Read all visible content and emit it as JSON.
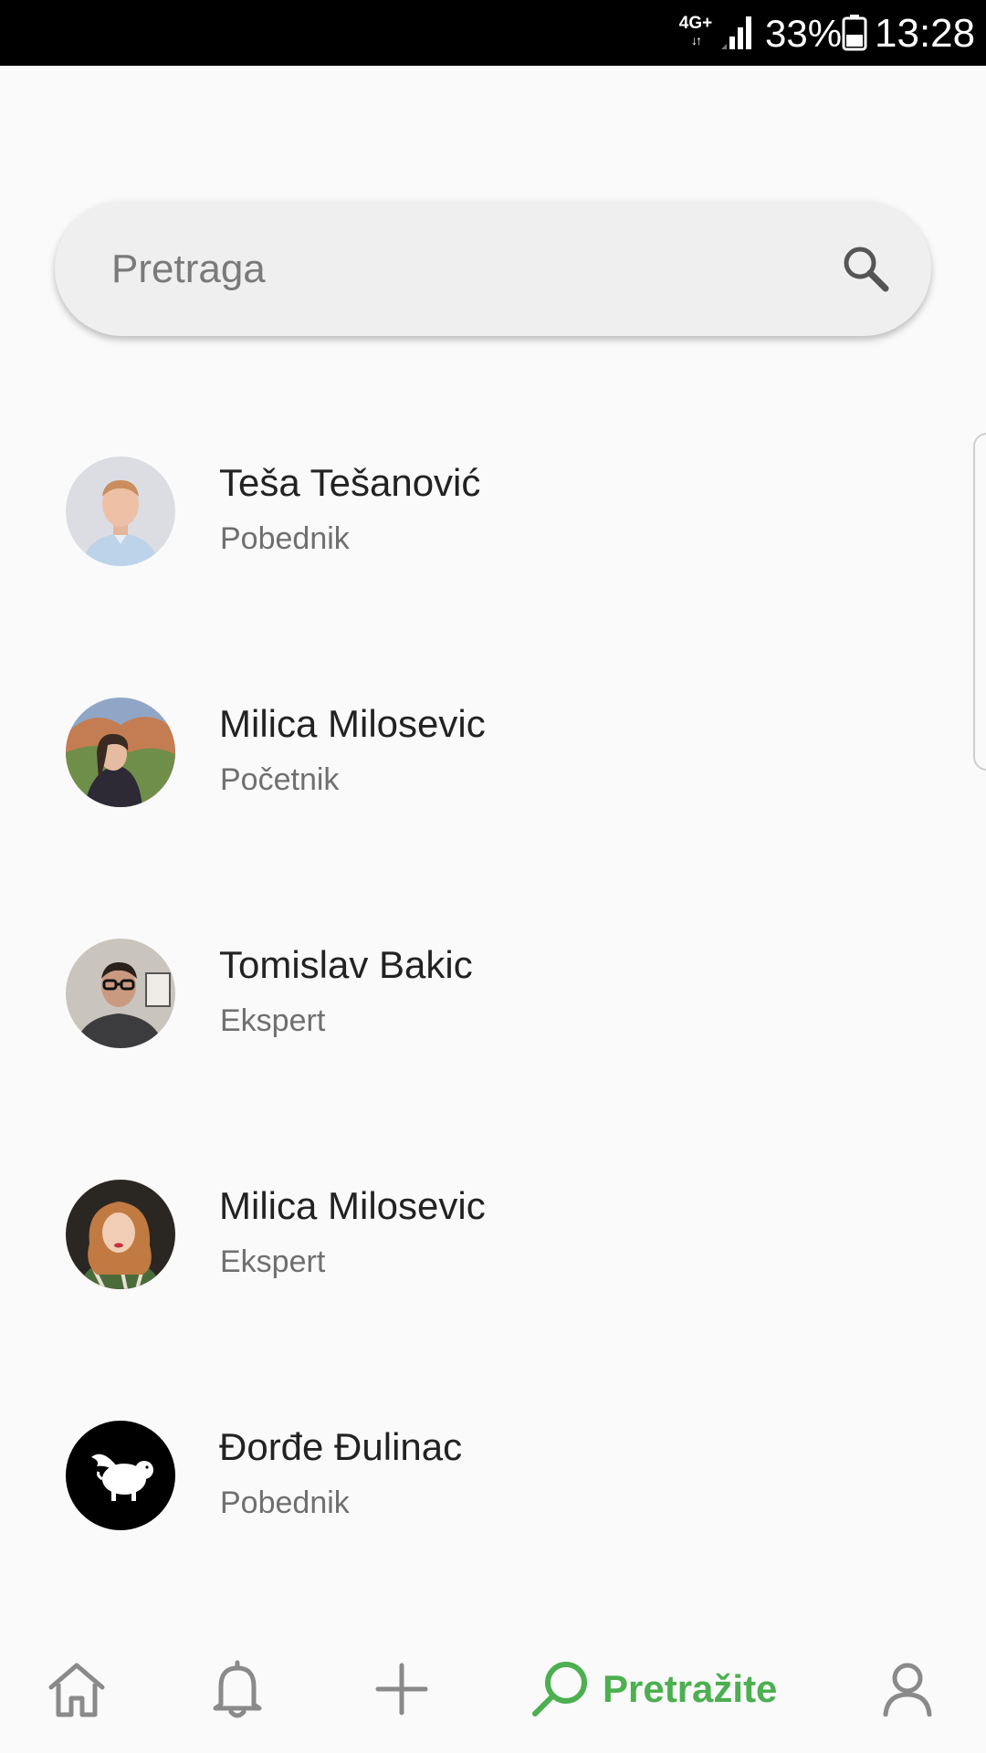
{
  "status_bar": {
    "network": "4G+",
    "battery": "33%",
    "time": "13:28",
    "icons": [
      "network-4g-icon",
      "signal-icon",
      "battery-icon"
    ]
  },
  "search": {
    "placeholder": "Pretraga",
    "icon": "search-icon"
  },
  "users": [
    {
      "name": "Teša Tešanović",
      "level": "Pobednik"
    },
    {
      "name": "Milica Milosevic",
      "level": "Početnik"
    },
    {
      "name": "Tomislav Bakic",
      "level": "Ekspert"
    },
    {
      "name": "Milica Milosevic",
      "level": "Ekspert"
    },
    {
      "name": "Đorđe Đulinac",
      "level": "Pobednik"
    }
  ],
  "nav": {
    "items": [
      "home-icon",
      "bell-icon",
      "plus-icon",
      "search-icon",
      "user-icon"
    ],
    "active_label": "Pretražite"
  },
  "colors": {
    "accent": "#4caf50",
    "nav_icon": "#8a8a8a",
    "background": "#fafafa",
    "search_bg": "#efefef"
  }
}
